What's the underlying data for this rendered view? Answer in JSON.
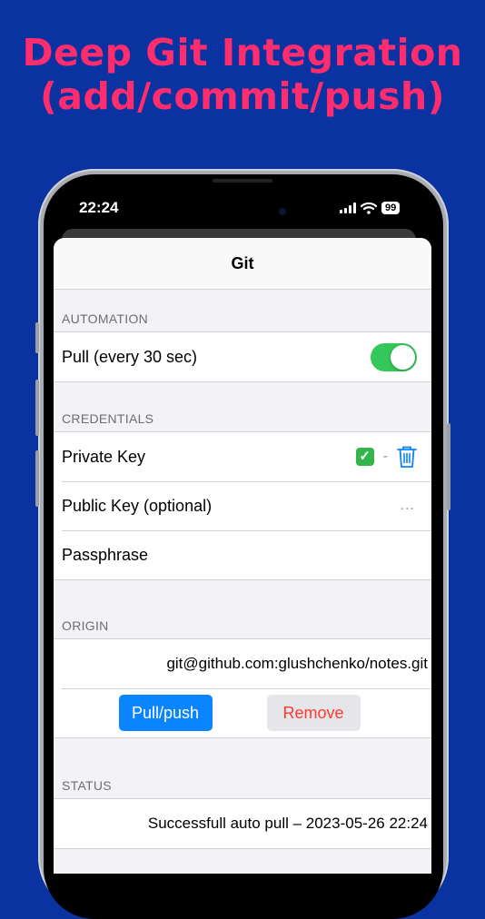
{
  "headline": {
    "line1": "Deep Git Integration",
    "line2": "(add/commit/push)"
  },
  "status_bar": {
    "time": "22:24",
    "battery": "99",
    "signal_icon": "cellular-signal-icon",
    "wifi_icon": "wifi-icon"
  },
  "sheet": {
    "title": "Git",
    "automation": {
      "section_title": "AUTOMATION",
      "pull_label": "Pull (every 30 sec)",
      "pull_enabled": true
    },
    "credentials": {
      "section_title": "CREDENTIALS",
      "private_key_label": "Private Key",
      "private_key_check": "✓",
      "separator": "-",
      "public_key_label": "Public Key (optional)",
      "public_key_more": "...",
      "passphrase_label": "Passphrase"
    },
    "origin": {
      "section_title": "ORIGIN",
      "url": "git@github.com:glushchenko/notes.git",
      "pull_push_label": "Pull/push",
      "remove_label": "Remove"
    },
    "status": {
      "section_title": "STATUS",
      "text": "Successfull auto pull – 2023-05-26 22:24"
    }
  },
  "colors": {
    "background": "#0a32a0",
    "headline": "#ff2d6e",
    "toggle_on": "#34c759",
    "accent": "#0a84ff",
    "destructive": "#ff3b30"
  }
}
